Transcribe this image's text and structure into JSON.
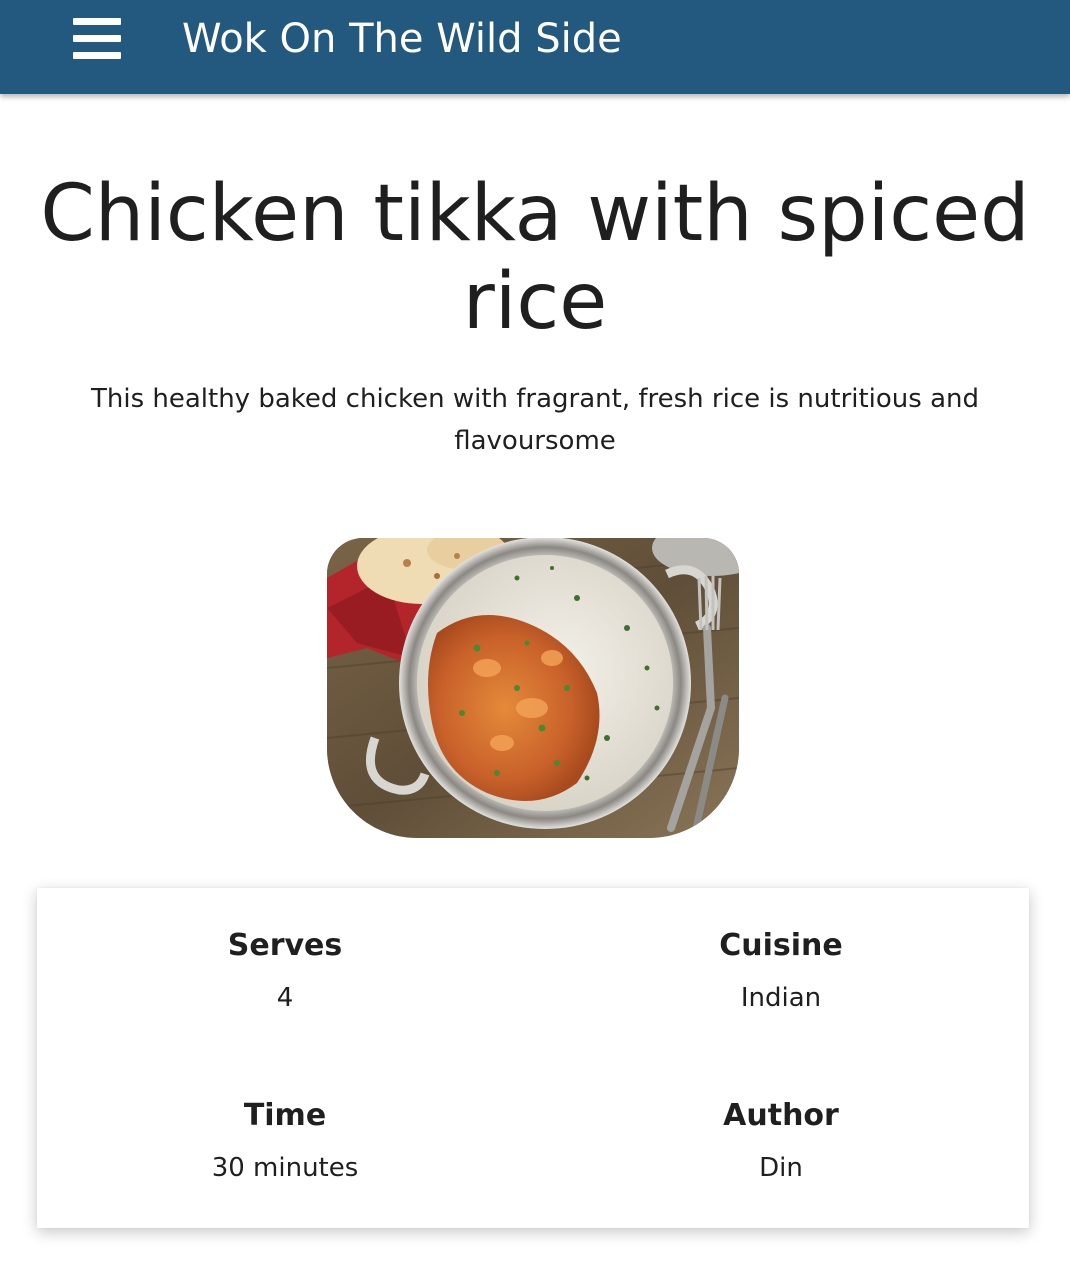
{
  "header": {
    "site_title": "Wok On The Wild Side",
    "menu_icon": "hamburger-menu-icon",
    "background_color": "#23587f"
  },
  "recipe": {
    "title": "Chicken tikka with spiced rice",
    "description": "This healthy baked chicken with fragrant, fresh rice is nutritious and flavoursome",
    "image_alt": "Chicken tikka with spiced rice"
  },
  "details": [
    {
      "label": "Serves",
      "value": "4"
    },
    {
      "label": "Cuisine",
      "value": "Indian"
    },
    {
      "label": "Time",
      "value": "30 minutes"
    },
    {
      "label": "Author",
      "value": "Din"
    }
  ]
}
